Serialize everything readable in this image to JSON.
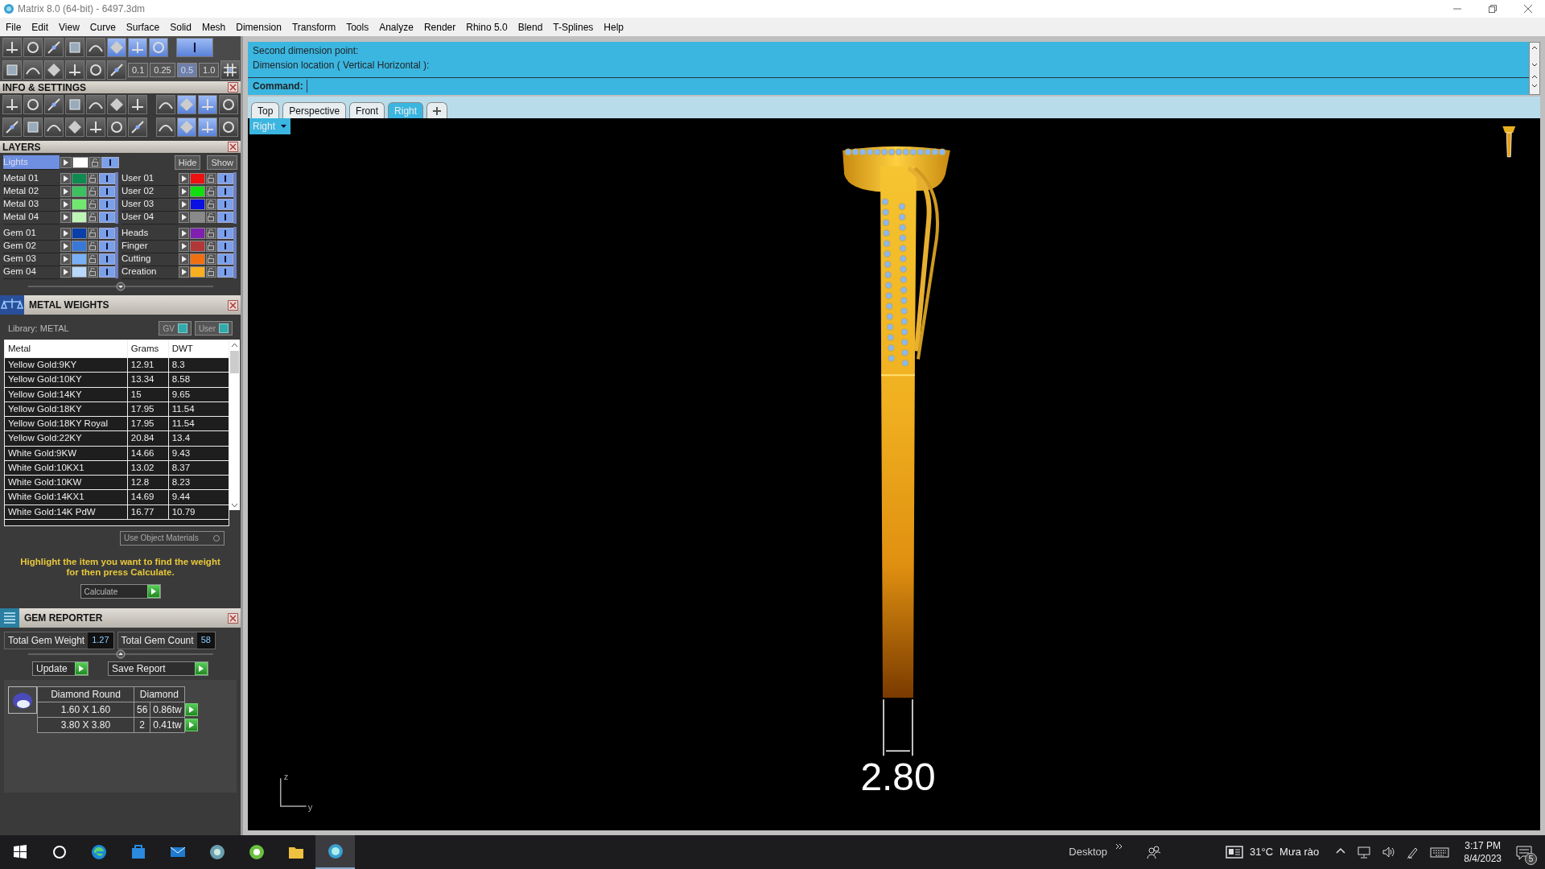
{
  "window": {
    "title": "Matrix 8.0 (64-bit) - 6497.3dm"
  },
  "menu": [
    "File",
    "Edit",
    "View",
    "Curve",
    "Surface",
    "Solid",
    "Mesh",
    "Dimension",
    "Transform",
    "Tools",
    "Analyze",
    "Render",
    "Rhino 5.0",
    "Blend",
    "T-Splines",
    "Help"
  ],
  "toolbar": {
    "snap_values": [
      {
        "label": "0.1",
        "selected": false
      },
      {
        "label": "0.25",
        "selected": false
      },
      {
        "label": "0.5",
        "selected": true
      },
      {
        "label": "1.0",
        "selected": false
      }
    ]
  },
  "info_settings": {
    "title": "INFO & SETTINGS"
  },
  "layers": {
    "title": "LAYERS",
    "lights": {
      "label": "Lights",
      "color": "#ffffff",
      "visible": true
    },
    "hide": "Hide",
    "show": "Show",
    "left": [
      [
        {
          "name": "Metal 01",
          "color": "#0f8a4f",
          "visible": true
        },
        {
          "name": "Metal 02",
          "color": "#3cc060",
          "visible": true
        },
        {
          "name": "Metal 03",
          "color": "#70e870",
          "visible": true
        },
        {
          "name": "Metal 04",
          "color": "#c0f5b8",
          "visible": true
        }
      ],
      [
        {
          "name": "Gem 01",
          "color": "#0a3ea8",
          "visible": true
        },
        {
          "name": "Gem 02",
          "color": "#3a78d8",
          "visible": true
        },
        {
          "name": "Gem 03",
          "color": "#78b0f8",
          "visible": true
        },
        {
          "name": "Gem 04",
          "color": "#b8d8fc",
          "visible": true
        }
      ]
    ],
    "right": [
      [
        {
          "name": "User 01",
          "color": "#ee1111",
          "visible": true
        },
        {
          "name": "User 02",
          "color": "#11dd11",
          "visible": true
        },
        {
          "name": "User 03",
          "color": "#0a10e0",
          "visible": true
        },
        {
          "name": "User 04",
          "color": "#8a8a8a",
          "visible": true
        }
      ],
      [
        {
          "name": "Heads",
          "color": "#8020b0",
          "visible": true
        },
        {
          "name": "Finger",
          "color": "#b03838",
          "visible": true
        },
        {
          "name": "Cutting",
          "color": "#f07010",
          "visible": true
        },
        {
          "name": "Creation",
          "color": "#f8b020",
          "visible": true
        }
      ]
    ]
  },
  "metal_weights": {
    "title": "METAL WEIGHTS",
    "library": "Library: METAL",
    "toggles": [
      "GV",
      "User"
    ],
    "columns": [
      "Metal",
      "Grams",
      "DWT"
    ],
    "rows": [
      [
        "Yellow Gold:9KY",
        "12.91",
        "8.3"
      ],
      [
        "Yellow Gold:10KY",
        "13.34",
        "8.58"
      ],
      [
        "Yellow Gold:14KY",
        "15",
        "9.65"
      ],
      [
        "Yellow Gold:18KY",
        "17.95",
        "11.54"
      ],
      [
        "Yellow Gold:18KY Royal",
        "17.95",
        "11.54"
      ],
      [
        "Yellow Gold:22KY",
        "20.84",
        "13.4"
      ],
      [
        "White Gold:9KW",
        "14.66",
        "9.43"
      ],
      [
        "White Gold:10KX1",
        "13.02",
        "8.37"
      ],
      [
        "White Gold:10KW",
        "12.8",
        "8.23"
      ],
      [
        "White Gold:14KX1",
        "14.69",
        "9.44"
      ],
      [
        "White Gold:14K PdW",
        "16.77",
        "10.79"
      ]
    ],
    "use_object_materials": "Use Object Materials",
    "hint": "Highlight the item you want to find the weight for then press Calculate.",
    "calculate": "Calculate"
  },
  "gem_reporter": {
    "title": "GEM REPORTER",
    "total_weight_label": "Total Gem Weight",
    "total_weight": "1.27",
    "total_count_label": "Total Gem Count",
    "total_count": "58",
    "update": "Update",
    "save_report": "Save Report",
    "header": [
      "Diamond Round",
      "Diamond"
    ],
    "rows": [
      [
        "1.60 X 1.60",
        "56",
        "0.86tw"
      ],
      [
        "3.80 X 3.80",
        "2",
        "0.41tw"
      ]
    ]
  },
  "command": {
    "history": [
      "Second dimension point:",
      "Dimension location ( Vertical  Horizontal ):"
    ],
    "prompt": "Command:"
  },
  "viewport_tabs": [
    {
      "label": "Top",
      "selected": false
    },
    {
      "label": "Perspective",
      "selected": false
    },
    {
      "label": "Front",
      "selected": false
    },
    {
      "label": "Right",
      "selected": true
    }
  ],
  "viewport": {
    "label": "Right",
    "dimension": "2.80",
    "axes": [
      "z",
      "y"
    ]
  },
  "taskbar": {
    "apps": [
      {
        "kind": "start",
        "selected": false
      },
      {
        "kind": "search",
        "selected": false
      },
      {
        "kind": "browser",
        "selected": false
      },
      {
        "kind": "store",
        "selected": false
      },
      {
        "kind": "mail",
        "selected": false
      },
      {
        "kind": "game",
        "selected": false
      },
      {
        "kind": "green",
        "selected": false
      },
      {
        "kind": "folder",
        "selected": false
      },
      {
        "kind": "matrix",
        "selected": true
      }
    ],
    "desktop": "Desktop",
    "temperature": "31°C",
    "weather": "Mưa rào",
    "time": "3:17 PM",
    "date": "8/4/2023",
    "notifications": "5"
  }
}
